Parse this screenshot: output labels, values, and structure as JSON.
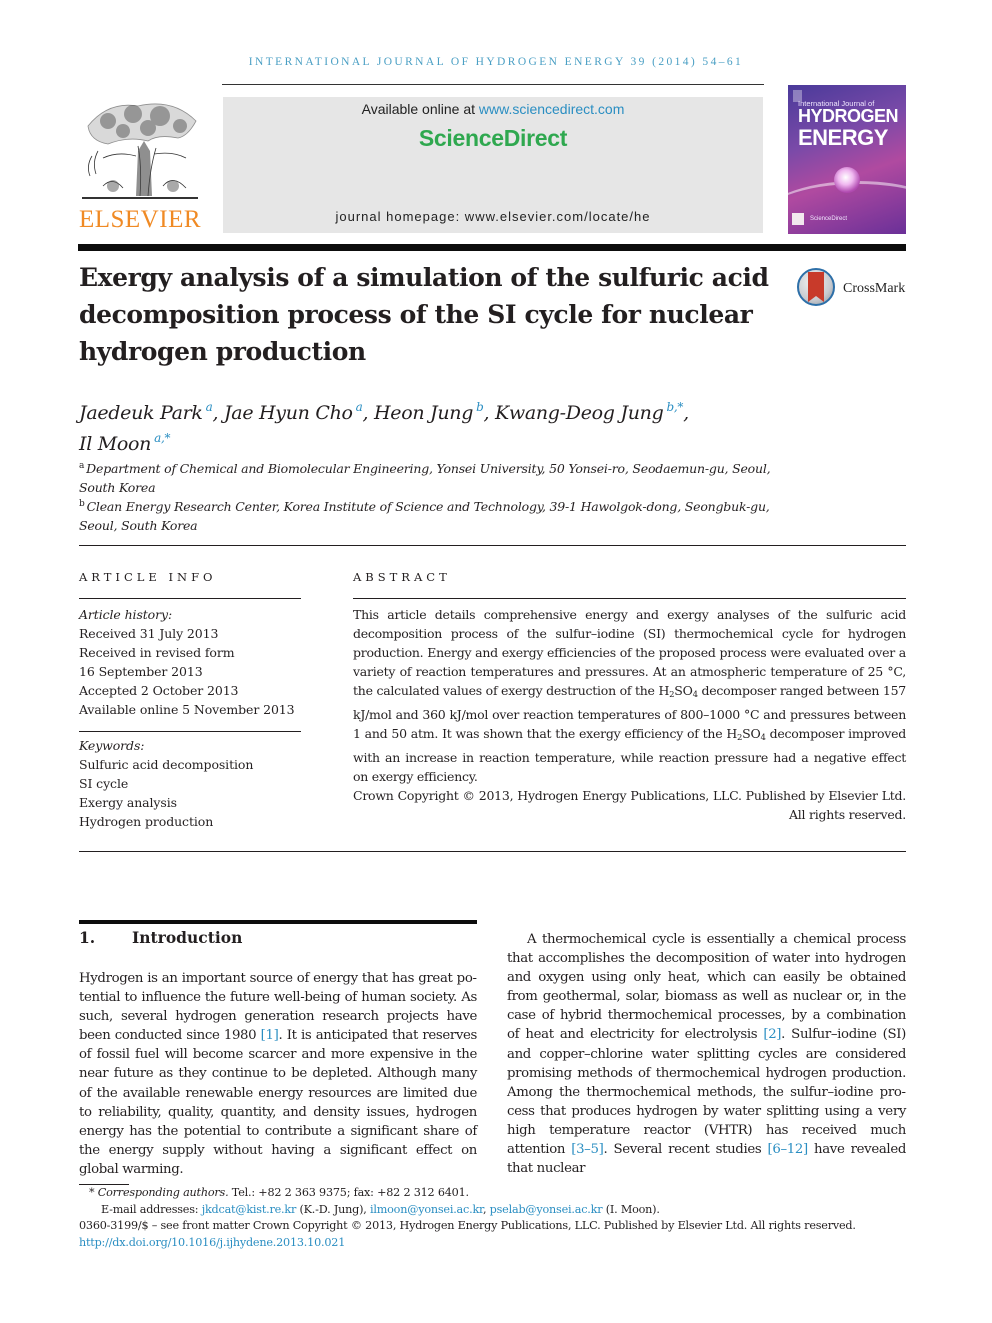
{
  "running_head": "INTERNATIONAL JOURNAL OF HYDROGEN ENERGY 39 (2014) 54–61",
  "publisher": {
    "logo_word": "ELSEVIER",
    "logo_icon": "elsevier-tree-icon"
  },
  "masthead": {
    "available_prefix": "Available online at ",
    "available_link": "www.sciencedirect.com",
    "brand": "ScienceDirect",
    "homepage_label": "journal homepage: www.elsevier.com/locate/he"
  },
  "cover": {
    "line1": "International Journal of",
    "line2": "HYDROGEN",
    "line3": "ENERGY",
    "footer": "ScienceDirect"
  },
  "article": {
    "title": "Exergy analysis of a simulation of the sulfuric acid decomposition process of the SI cycle for nuclear hydrogen production",
    "crossmark_label": "CrossMark",
    "authors": [
      {
        "name": "Jaedeuk Park",
        "sup": "a",
        "sep": ", "
      },
      {
        "name": "Jae Hyun Cho",
        "sup": "a",
        "sep": ", "
      },
      {
        "name": "Heon Jung",
        "sup": "b",
        "sep": ", "
      },
      {
        "name": "Kwang-Deog Jung",
        "sup": "b,*",
        "sep": ","
      },
      {
        "name": "Il Moon",
        "sup": "a,*",
        "sep": ""
      }
    ],
    "affiliations": [
      {
        "mark": "a",
        "text": "Department of Chemical and Biomolecular Engineering, Yonsei University, 50 Yonsei-ro, Seodaemun-gu, Seoul, South Korea"
      },
      {
        "mark": "b",
        "text": "Clean Energy Research Center, Korea Institute of Science and Technology, 39-1 Hawolgok-dong, Seongbuk-gu, Seoul, South Korea"
      }
    ]
  },
  "article_info": {
    "heading": "ARTICLE INFO",
    "history_label": "Article history:",
    "history": [
      "Received 31 July 2013",
      "Received in revised form",
      "16 September 2013",
      "Accepted 2 October 2013",
      "Available online 5 November 2013"
    ],
    "keywords_label": "Keywords:",
    "keywords": [
      "Sulfuric acid decomposition",
      "SI cycle",
      "Exergy analysis",
      "Hydrogen production"
    ]
  },
  "abstract": {
    "heading": "ABSTRACT",
    "p1": "This article details comprehensive energy and exergy analyses of the sulfuric acid decomposition process of the sulfur–iodine (SI) thermochemical cycle for hydrogen production. Energy and exergy efficiencies of the proposed process were evaluated over a variety of reaction temperatures and pressures. At an atmospheric temperature of 25 °C, the calculated values of exergy destruction of the ",
    "chem_a": "H",
    "chem_b": "2",
    "chem_c": "SO",
    "chem_d": "4",
    "p2": " decomposer ranged between 157 kJ/mol and 360 kJ/mol over reaction temperatures of 800–1000 °C and pressures between 1 and 50 atm. It was shown that the exergy efficiency of the ",
    "p3": " decomposer improved with an increase in reaction temperature, while reaction pressure had a negative effect on exergy efficiency.",
    "copyright": "Crown Copyright © 2013, Hydrogen Energy Publications, LLC. Published by Elsevier Ltd. All rights reserved."
  },
  "section1": {
    "number": "1.",
    "title": "Introduction",
    "left_a": "Hydrogen is an important source of energy that has great po­tential to influence the future well-being of human society. As such, several hydrogen generation research projects have been conducted since 1980 ",
    "left_ref1": "[1]",
    "left_b": ". It is anticipated that reserves of fossil fuel will become scarcer and more expensive in the near future as they continue to be depleted. Although many of the available renewable energy resources are limited due to reliability, quality, quantity, and density issues, hydrogen energy has the potential to contribute a significant share of the energy supply without having a significant effect on global warming.",
    "right_a": "A thermochemical cycle is essentially a chemical process that accomplishes the decomposition of water into hydrogen and oxygen using only heat, which can easily be obtained from geothermal, solar, biomass as well as nuclear or, in the case of hybrid thermochemical processes, by a combination of heat and electricity for electrolysis ",
    "right_ref2": "[2]",
    "right_b": ". Sulfur–iodine (SI) and copper–chlorine water splitting cycles are considered prom­ising methods of thermochemical hydrogen production. Among the thermochemical methods, the sulfur–iodine pro­cess that produces hydrogen by water splitting using a very high temperature reactor (VHTR) has received much attention ",
    "right_ref3": "[3–5]",
    "right_c": ". Several recent studies ",
    "right_ref4": "[6–12]",
    "right_d": " have revealed that nuclear"
  },
  "footnotes": {
    "star": "*",
    "corr_label": "Corresponding authors.",
    "corr_contact": " Tel.: +82 2 363 9375; fax: +82 2 312 6401.",
    "email_label": "E-mail addresses: ",
    "email1": "jkdcat@kist.re.kr",
    "email1_owner": " (K.-D. Jung), ",
    "email2": "ilmoon@yonsei.ac.kr",
    "email_sep": ", ",
    "email3": "pselab@yonsei.ac.kr",
    "email3_owner": " (I. Moon).",
    "issn_line": "0360-3199/$ – see front matter Crown Copyright © 2013, Hydrogen Energy Publications, LLC. Published by Elsevier Ltd. All rights reserved.",
    "doi": "http://dx.doi.org/10.1016/j.ijhydene.2013.10.021"
  },
  "colors": {
    "link": "#2a8ec2",
    "running_head": "#4a9fc4",
    "elsevier_orange": "#f08a24",
    "sciencedirect_green": "#2fa84f",
    "masthead_bg": "#e6e6e6"
  }
}
